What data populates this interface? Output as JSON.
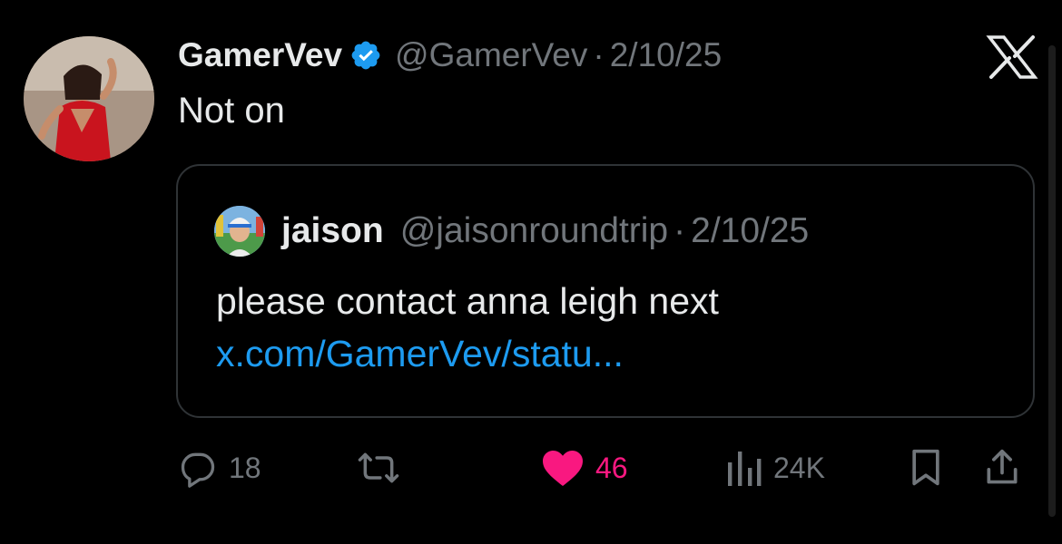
{
  "tweet": {
    "display_name": "GamerVev",
    "handle": "@GamerVev",
    "separator": "·",
    "date": "2/10/25",
    "text": "Not on",
    "verified": true
  },
  "quoted_tweet": {
    "display_name": "jaison",
    "handle": "@jaisonroundtrip",
    "separator": "·",
    "date": "2/10/25",
    "text": "please contact anna leigh next ",
    "link_text": "x.com/GamerVev/statu..."
  },
  "actions": {
    "replies": "18",
    "likes": "46",
    "views": "24K",
    "liked": true
  },
  "icons": {
    "reply": "comment-bubble-icon",
    "retweet": "retweet-icon",
    "like": "heart-icon",
    "views": "bar-chart-icon",
    "bookmark": "bookmark-icon",
    "share": "share-icon",
    "brand": "x-logo-icon",
    "verified": "verified-badge-icon"
  },
  "colors": {
    "background": "#000000",
    "text": "#e7e9ea",
    "secondary": "#71767b",
    "link": "#1d9bf0",
    "like": "#f91880",
    "verified": "#1d9bf0",
    "border": "#2f3336"
  }
}
